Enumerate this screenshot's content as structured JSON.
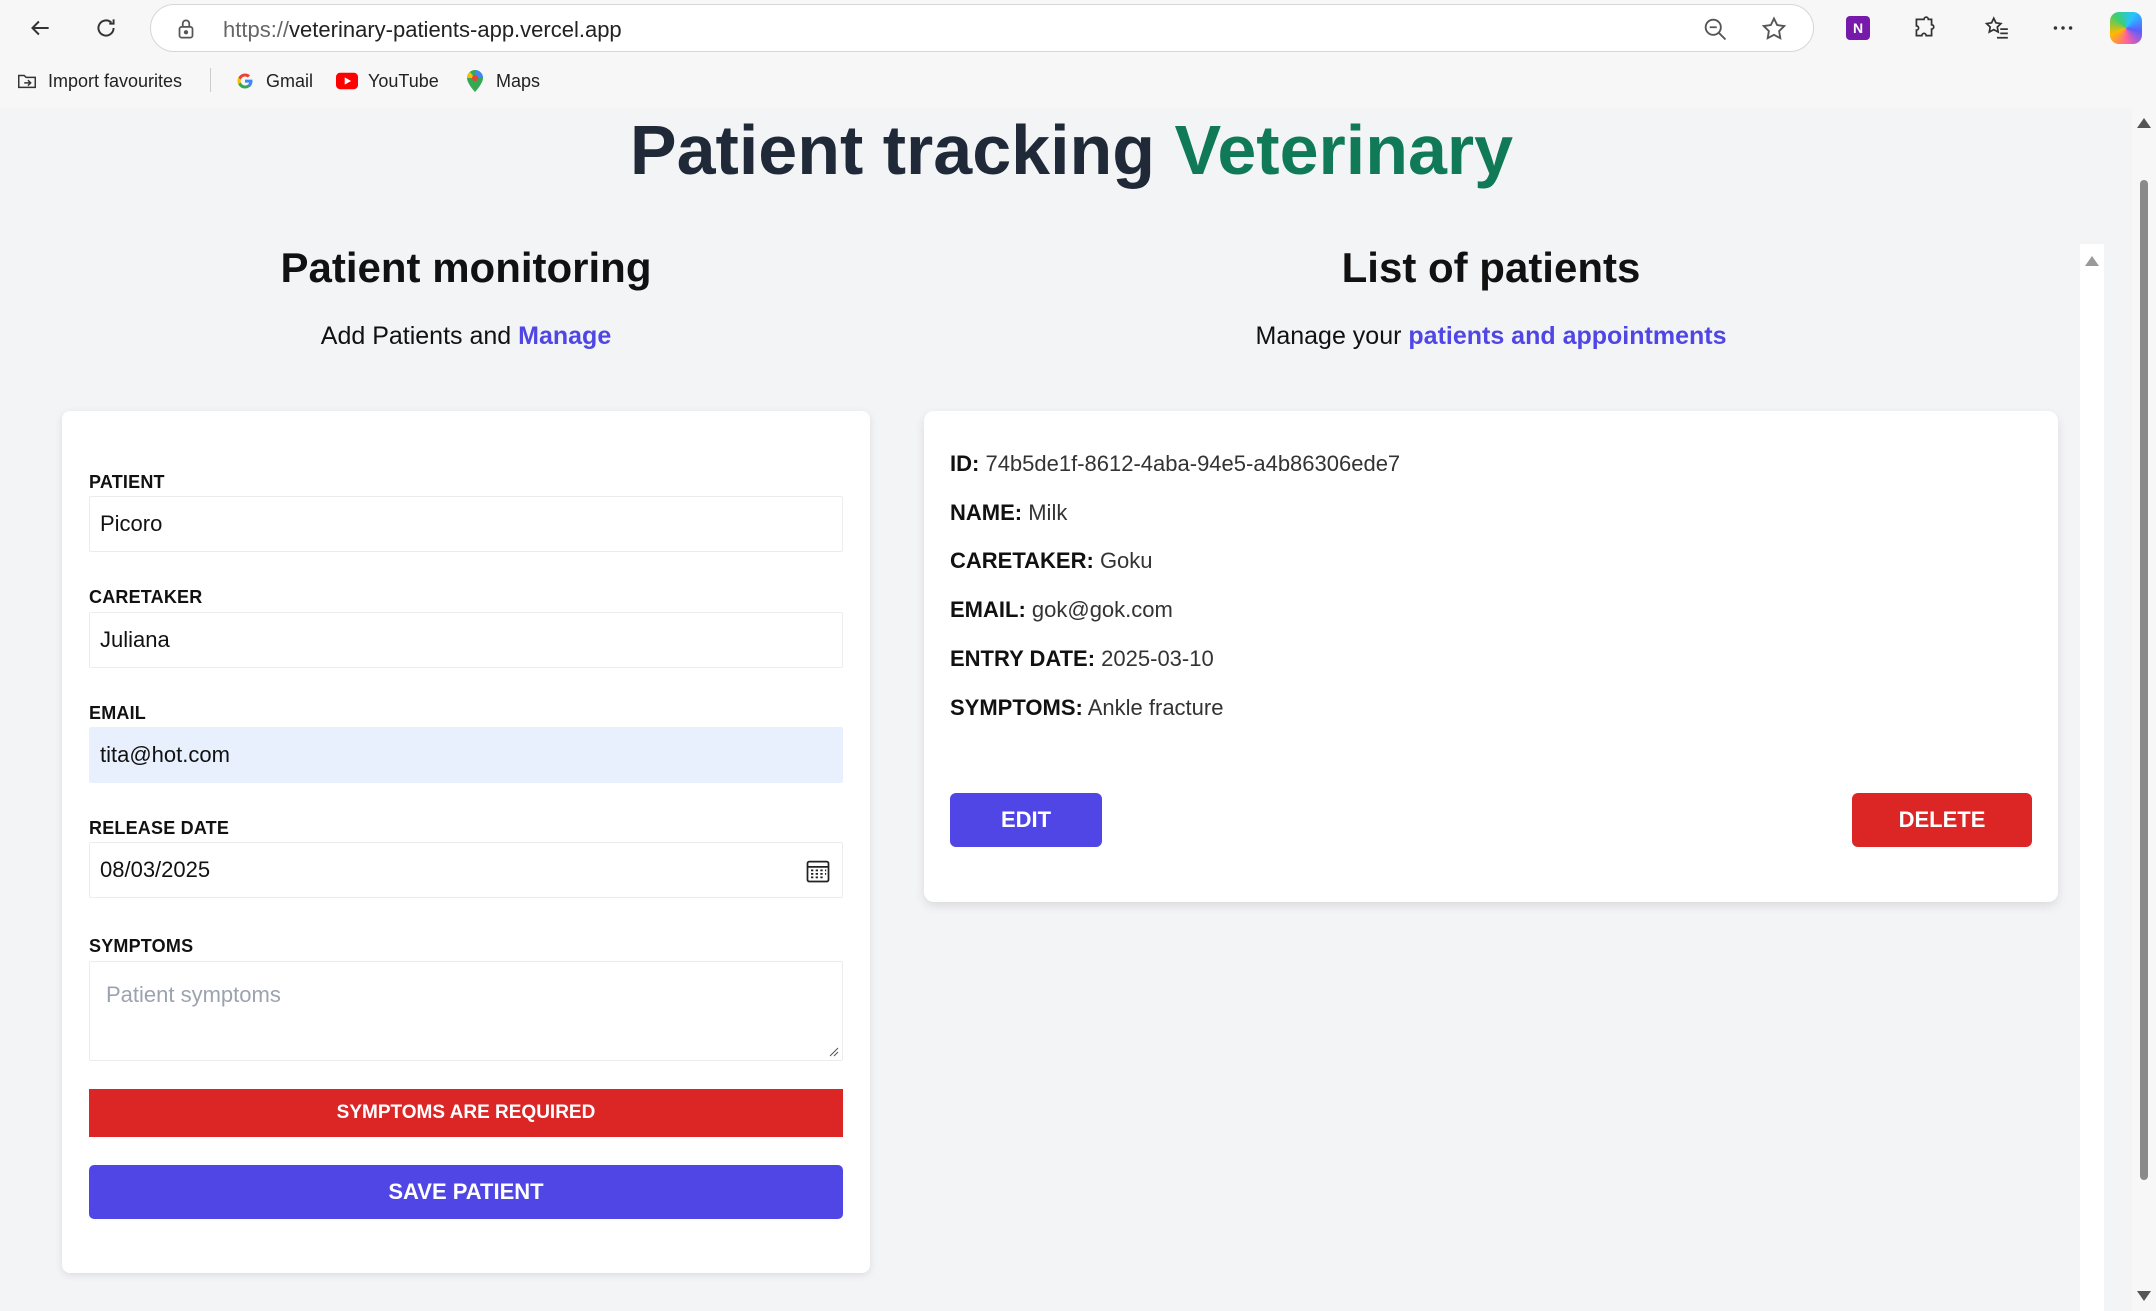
{
  "browser": {
    "url_protocol": "https://",
    "url_host": "veterinary-patients-app.vercel.app",
    "bookmarks": [
      {
        "label": "Import favourites"
      },
      {
        "label": "Gmail"
      },
      {
        "label": "YouTube"
      },
      {
        "label": "Maps"
      }
    ]
  },
  "page": {
    "title_main": "Patient tracking",
    "title_accent": "Veterinary",
    "accent_color": "#0f7a55"
  },
  "monitoring": {
    "title": "Patient monitoring",
    "subtitle_prefix": "Add Patients and",
    "subtitle_accent": "Manage"
  },
  "form": {
    "patient_label": "Patient",
    "patient_value": "Picoro",
    "caretaker_label": "Caretaker",
    "caretaker_value": "Juliana",
    "email_label": "Email",
    "email_value": "tita@hot.com",
    "release_date_label": "Release date",
    "release_date_value": "08/03/2025",
    "symptoms_label": "Symptoms",
    "symptoms_placeholder": "Patient symptoms",
    "error_message": "Symptoms are required",
    "save_label": "Save Patient",
    "primary_color": "#4f46e5",
    "error_color": "#dc2626"
  },
  "patients_section": {
    "title": "List of patients",
    "subtitle_prefix": "Manage your",
    "subtitle_accent": "patients and appointments"
  },
  "patients": [
    {
      "id_label": "ID:",
      "id": "74b5de1f-8612-4aba-94e5-a4b86306ede7",
      "name_label": "Name:",
      "name": "Milk",
      "caretaker_label": "Caretaker:",
      "caretaker": "Goku",
      "email_label": "Email:",
      "email": "gok@gok.com",
      "entry_date_label": "Entry date:",
      "entry_date": "2025-03-10",
      "symptoms_label": "Symptoms:",
      "symptoms": "Ankle fracture",
      "edit_label": "Edit",
      "delete_label": "Delete"
    }
  ]
}
